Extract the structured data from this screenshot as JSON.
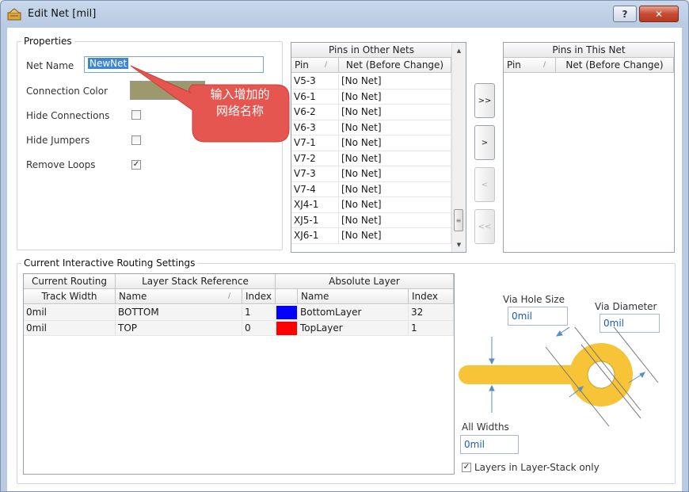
{
  "window": {
    "title": "Edit Net [mil]",
    "help_label": "?",
    "close_label": "✕"
  },
  "properties": {
    "group_title": "Properties",
    "net_name_label": "Net Name",
    "net_name_value": "NewNet",
    "connection_color_label": "Connection Color",
    "connection_color": "#9c9a6c",
    "hide_connections_label": "Hide Connections",
    "hide_connections": false,
    "hide_jumpers_label": "Hide Jumpers",
    "hide_jumpers": false,
    "remove_loops_label": "Remove Loops",
    "remove_loops": true,
    "check_glyph": "✓"
  },
  "callout": {
    "line1": "输入增加的",
    "line2": "网络名称"
  },
  "pins_other": {
    "title": "Pins in Other Nets",
    "col_pin": "Pin",
    "col_net": "Net (Before Change)",
    "sort_glyph": "/",
    "rows": [
      {
        "pin": "V5-3",
        "net": "[No Net]"
      },
      {
        "pin": "V6-1",
        "net": "[No Net]"
      },
      {
        "pin": "V6-2",
        "net": "[No Net]"
      },
      {
        "pin": "V6-3",
        "net": "[No Net]"
      },
      {
        "pin": "V7-1",
        "net": "[No Net]"
      },
      {
        "pin": "V7-2",
        "net": "[No Net]"
      },
      {
        "pin": "V7-3",
        "net": "[No Net]"
      },
      {
        "pin": "V7-4",
        "net": "[No Net]"
      },
      {
        "pin": "XJ4-1",
        "net": "[No Net]"
      },
      {
        "pin": "XJ5-1",
        "net": "[No Net]"
      },
      {
        "pin": "XJ6-1",
        "net": "[No Net]"
      }
    ]
  },
  "pins_this": {
    "title": "Pins in This Net",
    "col_pin": "Pin",
    "col_net": "Net (Before Change)",
    "sort_glyph": "/"
  },
  "move_buttons": {
    "add_all": ">>",
    "add": ">",
    "remove": "<",
    "remove_all": "<<"
  },
  "routing": {
    "group_title": "Current Interactive Routing Settings",
    "hdr_current_routing": "Current Routing",
    "hdr_layer_stack": "Layer Stack Reference",
    "hdr_absolute_layer": "Absolute Layer",
    "col_track_width": "Track Width",
    "col_name": "Name",
    "col_index": "Index",
    "col_abs_name": "Name",
    "col_abs_index": "Index",
    "sort_glyph": "/",
    "rows": [
      {
        "width": "0mil",
        "name": "BOTTOM",
        "index": "1",
        "color": "#0000ff",
        "abs_name": "BottomLayer",
        "abs_index": "32"
      },
      {
        "width": "0mil",
        "name": "TOP",
        "index": "0",
        "color": "#ff0000",
        "abs_name": "TopLayer",
        "abs_index": "1"
      }
    ]
  },
  "via": {
    "hole_size_label": "Via Hole Size",
    "hole_size_value": "0mil",
    "diameter_label": "Via Diameter",
    "diameter_value": "0mil",
    "all_widths_label": "All Widths",
    "all_widths_value": "0mil",
    "layers_only_label": "Layers in Layer-Stack only",
    "layers_only": true,
    "track_color": "#f6c436"
  }
}
